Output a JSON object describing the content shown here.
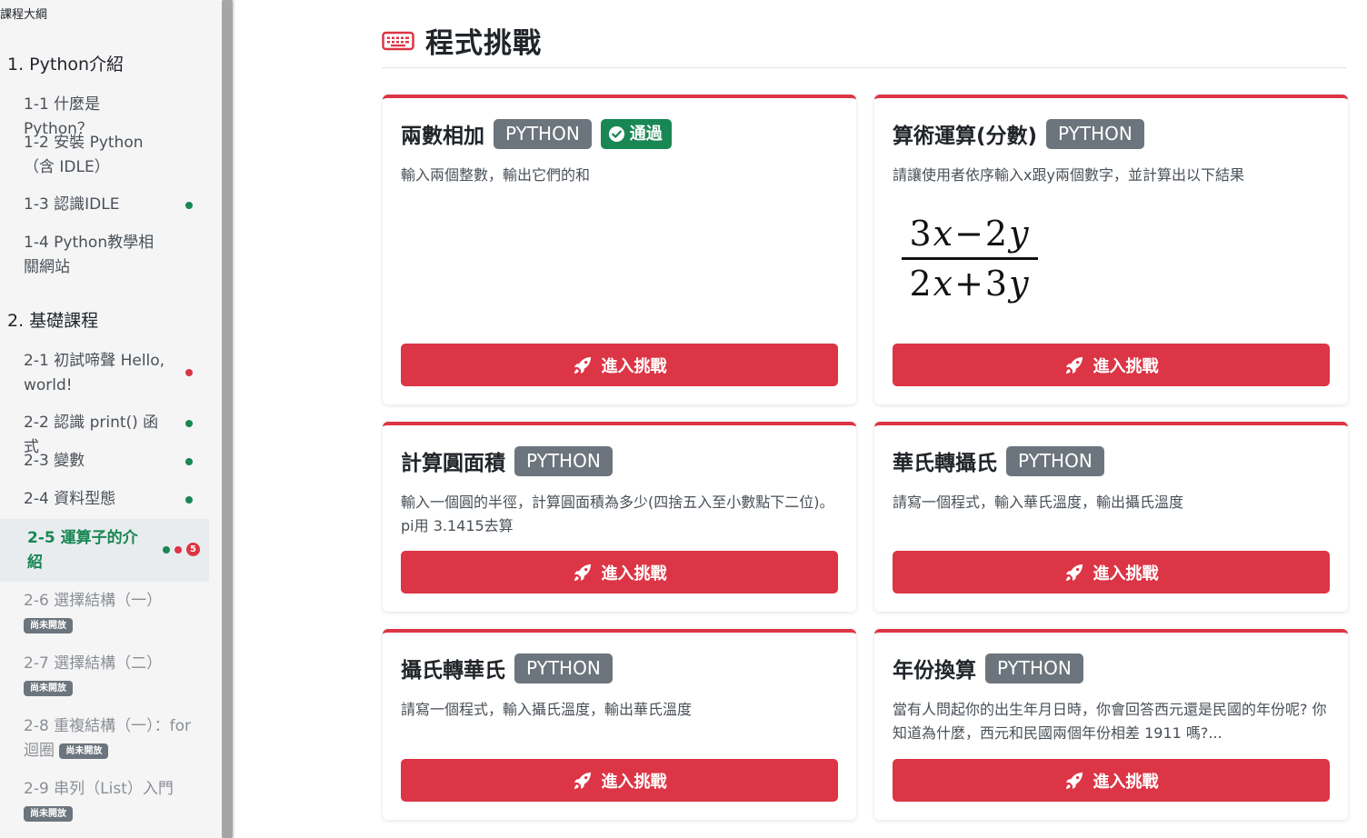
{
  "sidebar": {
    "header": "課程大綱",
    "chapters": [
      {
        "label": "1. Python介紹"
      },
      {
        "label": "2. 基礎課程"
      }
    ],
    "lessons": [
      {
        "label": "1-1 什麼是Python？"
      },
      {
        "label": "1-2 安裝 Python（含 IDLE）"
      },
      {
        "label": "1-3 認識IDLE"
      },
      {
        "label": "1-4 Python教學相關網站"
      },
      {
        "label": "2-1 初試啼聲 Hello, world!"
      },
      {
        "label": "2-2 認識 print() 函式"
      },
      {
        "label": "2-3 變數"
      },
      {
        "label": "2-4 資料型態"
      },
      {
        "label": "2-5 運算子的介紹",
        "count": "5"
      },
      {
        "label": "2-6 選擇結構（一）"
      },
      {
        "label": "2-7 選擇結構（二）"
      },
      {
        "label": "2-8 重複結構（一）：for 迴圈"
      },
      {
        "label": "2-9 串列（List）入門"
      }
    ],
    "locked_badge": "尚未開放"
  },
  "main": {
    "title": "程式挑戰",
    "button_label": "進入挑戰",
    "cards": [
      {
        "title": "兩數相加",
        "lang": "PYTHON",
        "status": "通過",
        "desc": "輸入兩個整數，輸出它們的和"
      },
      {
        "title": "算術運算(分數)",
        "lang": "PYTHON",
        "desc": "請讓使用者依序輸入x跟y兩個數字，並計算出以下結果"
      },
      {
        "title": "計算圓面積",
        "lang": "PYTHON",
        "desc": "輸入一個圓的半徑，計算圓面積為多少(四捨五入至小數點下二位)。 pi用 3.1415去算"
      },
      {
        "title": "華氏轉攝氏",
        "lang": "PYTHON",
        "desc": "請寫一個程式，輸入華氏溫度，輸出攝氏溫度"
      },
      {
        "title": "攝氏轉華氏",
        "lang": "PYTHON",
        "desc": "請寫一個程式，輸入攝氏溫度，輸出華氏溫度"
      },
      {
        "title": "年份換算",
        "lang": "PYTHON",
        "desc": "當有人問起你的出生年月日時，你會回答西元還是民國的年份呢? 你知道為什麼，西元和民國兩個年份相差 1911 嗎?..."
      }
    ],
    "formula": {
      "num_a": "3",
      "num_x": "x",
      "num_op": "−",
      "num_b": "2",
      "num_y": "y",
      "den_a": "2",
      "den_x": "x",
      "den_op": "+",
      "den_b": "3",
      "den_y": "y"
    }
  },
  "colors": {
    "accent": "#dc3545",
    "success": "#198754",
    "badge": "#6c757d"
  }
}
